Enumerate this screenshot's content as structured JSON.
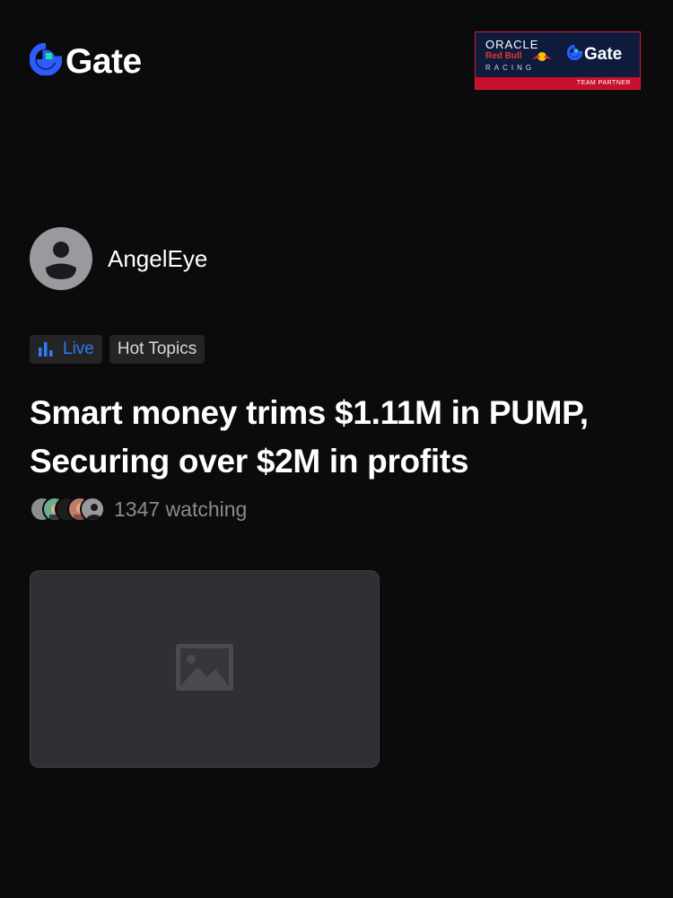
{
  "header": {
    "logo_text": "Gate",
    "partner_badge": {
      "oracle": "ORACLE",
      "red_bull": "Red Bull",
      "racing": "RACING",
      "gate": "Gate",
      "team_partner": "TEAM PARTNER"
    }
  },
  "author": {
    "name": "AngelEye"
  },
  "tags": {
    "live": "Live",
    "hot_topics": "Hot Topics"
  },
  "post": {
    "title": "Smart money trims $1.11M in PUMP, Securing over $2M in profits",
    "watching_count": "1347",
    "watching_label": "1347 watching"
  },
  "icons": {
    "logo": "gate-logo-icon",
    "avatar": "default-avatar-icon",
    "live": "bar-chart-icon",
    "image": "image-placeholder-icon"
  },
  "colors": {
    "accent": "#2f7bf5",
    "logo_green": "#17e5a3",
    "background": "#0b0b0c",
    "partner_red": "#c8102e"
  }
}
